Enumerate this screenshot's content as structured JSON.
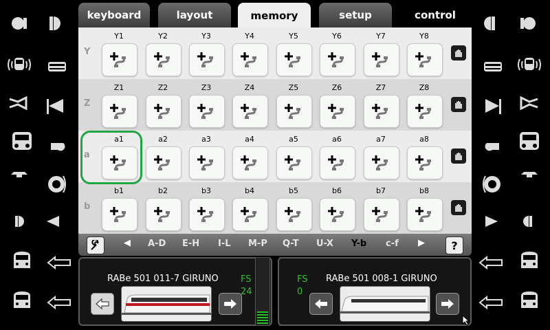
{
  "tabs": [
    {
      "label": "keyboard"
    },
    {
      "label": "layout"
    },
    {
      "label": "memory"
    },
    {
      "label": "setup"
    },
    {
      "label": "control"
    }
  ],
  "memory": {
    "rows": [
      {
        "label": "Y",
        "cells": [
          "Y1",
          "Y2",
          "Y3",
          "Y4",
          "Y5",
          "Y6",
          "Y7",
          "Y8"
        ]
      },
      {
        "label": "Z",
        "cells": [
          "Z1",
          "Z2",
          "Z3",
          "Z4",
          "Z5",
          "Z6",
          "Z7",
          "Z8"
        ]
      },
      {
        "label": "a",
        "cells": [
          "a1",
          "a2",
          "a3",
          "a4",
          "a5",
          "a6",
          "a7",
          "a8"
        ]
      },
      {
        "label": "b",
        "cells": [
          "b1",
          "b2",
          "b3",
          "b4",
          "b5",
          "b6",
          "b7",
          "b8"
        ]
      }
    ],
    "selected_cell": "a1"
  },
  "pager": {
    "pages": [
      "A-D",
      "E-H",
      "I-L",
      "M-P",
      "Q-T",
      "U-X",
      "Y-b",
      "c-f"
    ],
    "current": "Y-b",
    "help_label": "?"
  },
  "cabs": [
    {
      "name": "RABe 501 011-7 GIRUNO",
      "speed_label": "FS",
      "speed_value": "24",
      "speed_fraction": 0.19
    },
    {
      "name": "RABe 501 008-1 GIRUNO",
      "speed_label": "FS",
      "speed_value": "0",
      "speed_fraction": 0.0
    }
  ],
  "icons": {
    "left_functions": [
      "light-icon",
      "horn-low-icon",
      "sound-icon",
      "train-bell-icon",
      "horn-icon",
      "signal-horn-icon",
      "loco-front-icon",
      "whistle-icon",
      "ventilator-icon",
      "fan-icon",
      "cab-light-icon",
      "signal-horn-icon",
      "loco-side-icon",
      "arrow-left-icon",
      "loco-side-icon",
      "arrow-left-icon"
    ],
    "right_functions": [
      "horn-low-icon",
      "light-icon",
      "bell-icon",
      "sound-icon",
      "signal-horn-icon",
      "horn-icon",
      "whistle-icon",
      "loco-front-icon",
      "fan-icon",
      "ventilator-icon",
      "signal-horn-icon",
      "cab-light-icon",
      "arrow-left-icon",
      "loco-side-icon",
      "arrow-left-icon",
      "loco-side-icon"
    ]
  },
  "colors": {
    "accent": "#22a544",
    "speed": "#2ec02e"
  }
}
